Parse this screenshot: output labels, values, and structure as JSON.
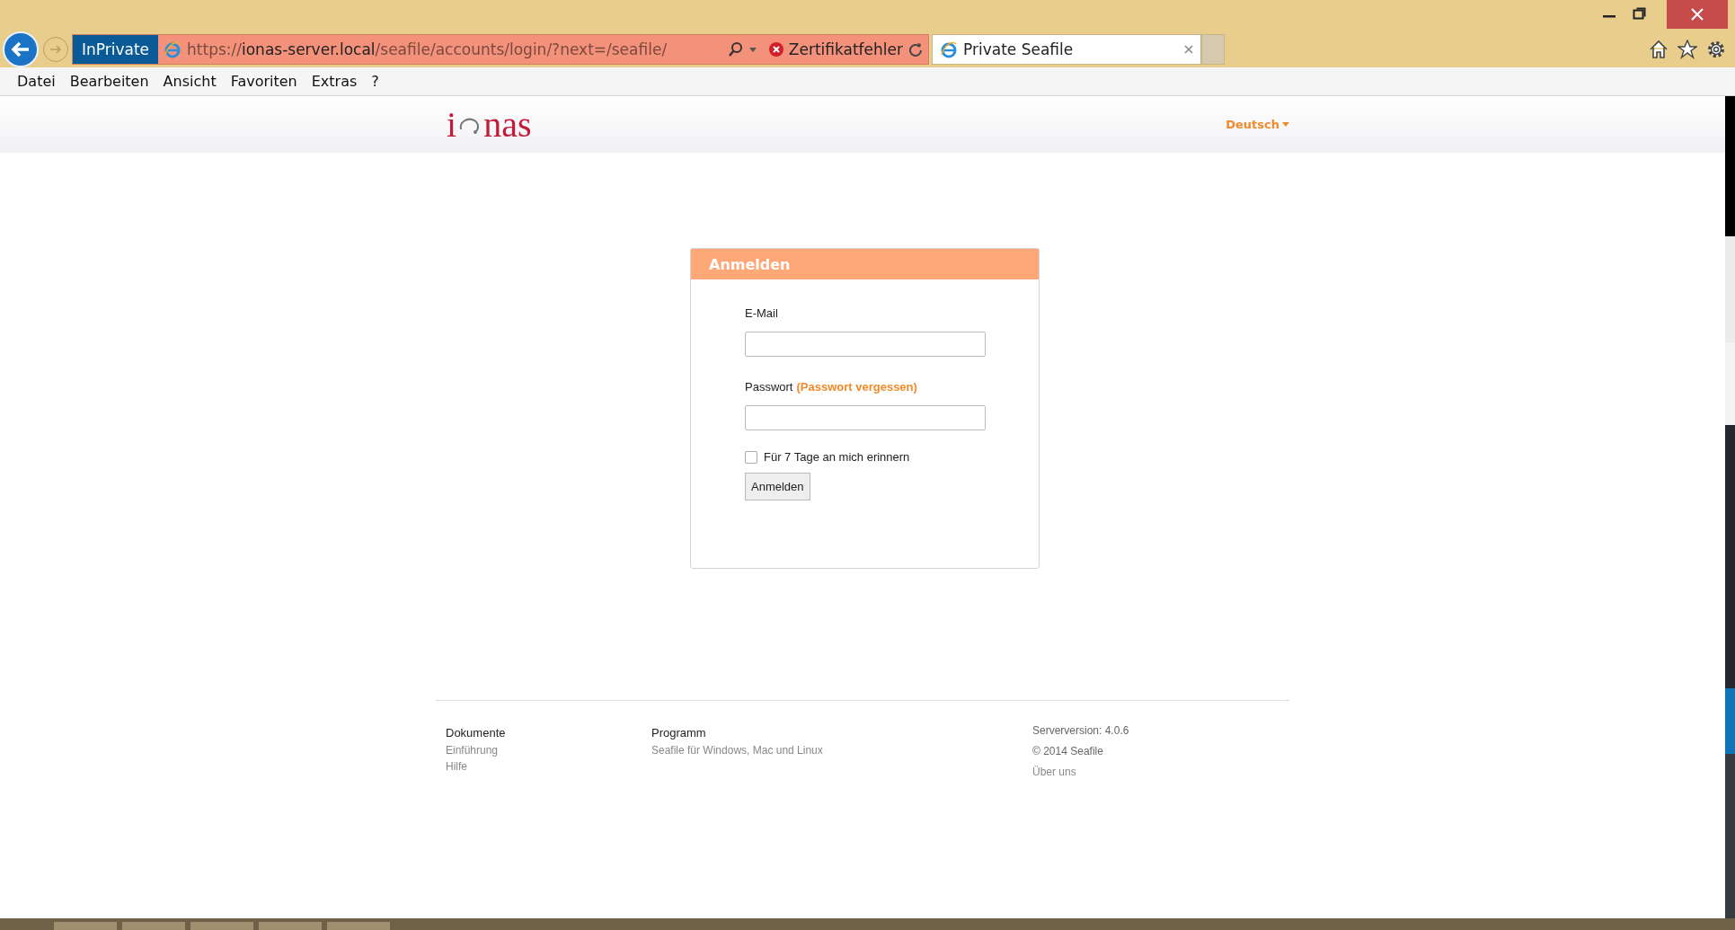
{
  "browser": {
    "inprivate": "InPrivate",
    "url": [
      {
        "kind": "scheme",
        "text": "https://"
      },
      {
        "kind": "host",
        "text": "ionas-server.local"
      },
      {
        "kind": "path",
        "text": "/seafile/accounts/login/?next=/seafile/"
      }
    ],
    "cert_error": "Zertifikatfehler",
    "tabs": [
      {
        "title": "Private Seafile",
        "selected": true
      }
    ],
    "menu": [
      "Datei",
      "Bearbeiten",
      "Ansicht",
      "Favoriten",
      "Extras",
      "?"
    ]
  },
  "header": {
    "logo": {
      "before": "i",
      "after": "nas"
    },
    "language": "Deutsch"
  },
  "login": {
    "title": "Anmelden",
    "email_label": "E-Mail",
    "password_label": "Passwort",
    "forgot_link": "(Passwort vergessen)",
    "remember": {
      "label": "Für 7 Tage an mich erinnern",
      "checked": false
    },
    "submit": "Anmelden"
  },
  "footer": {
    "columns": [
      {
        "heading": "Dokumente",
        "links": [
          "Einführung",
          "Hilfe"
        ]
      },
      {
        "heading": "Programm",
        "links": [
          "Seafile für Windows, Mac und Linux"
        ]
      }
    ],
    "server_version": "Serverversion: 4.0.6",
    "copyright": "© 2014 Seafile",
    "about": "Über uns"
  }
}
